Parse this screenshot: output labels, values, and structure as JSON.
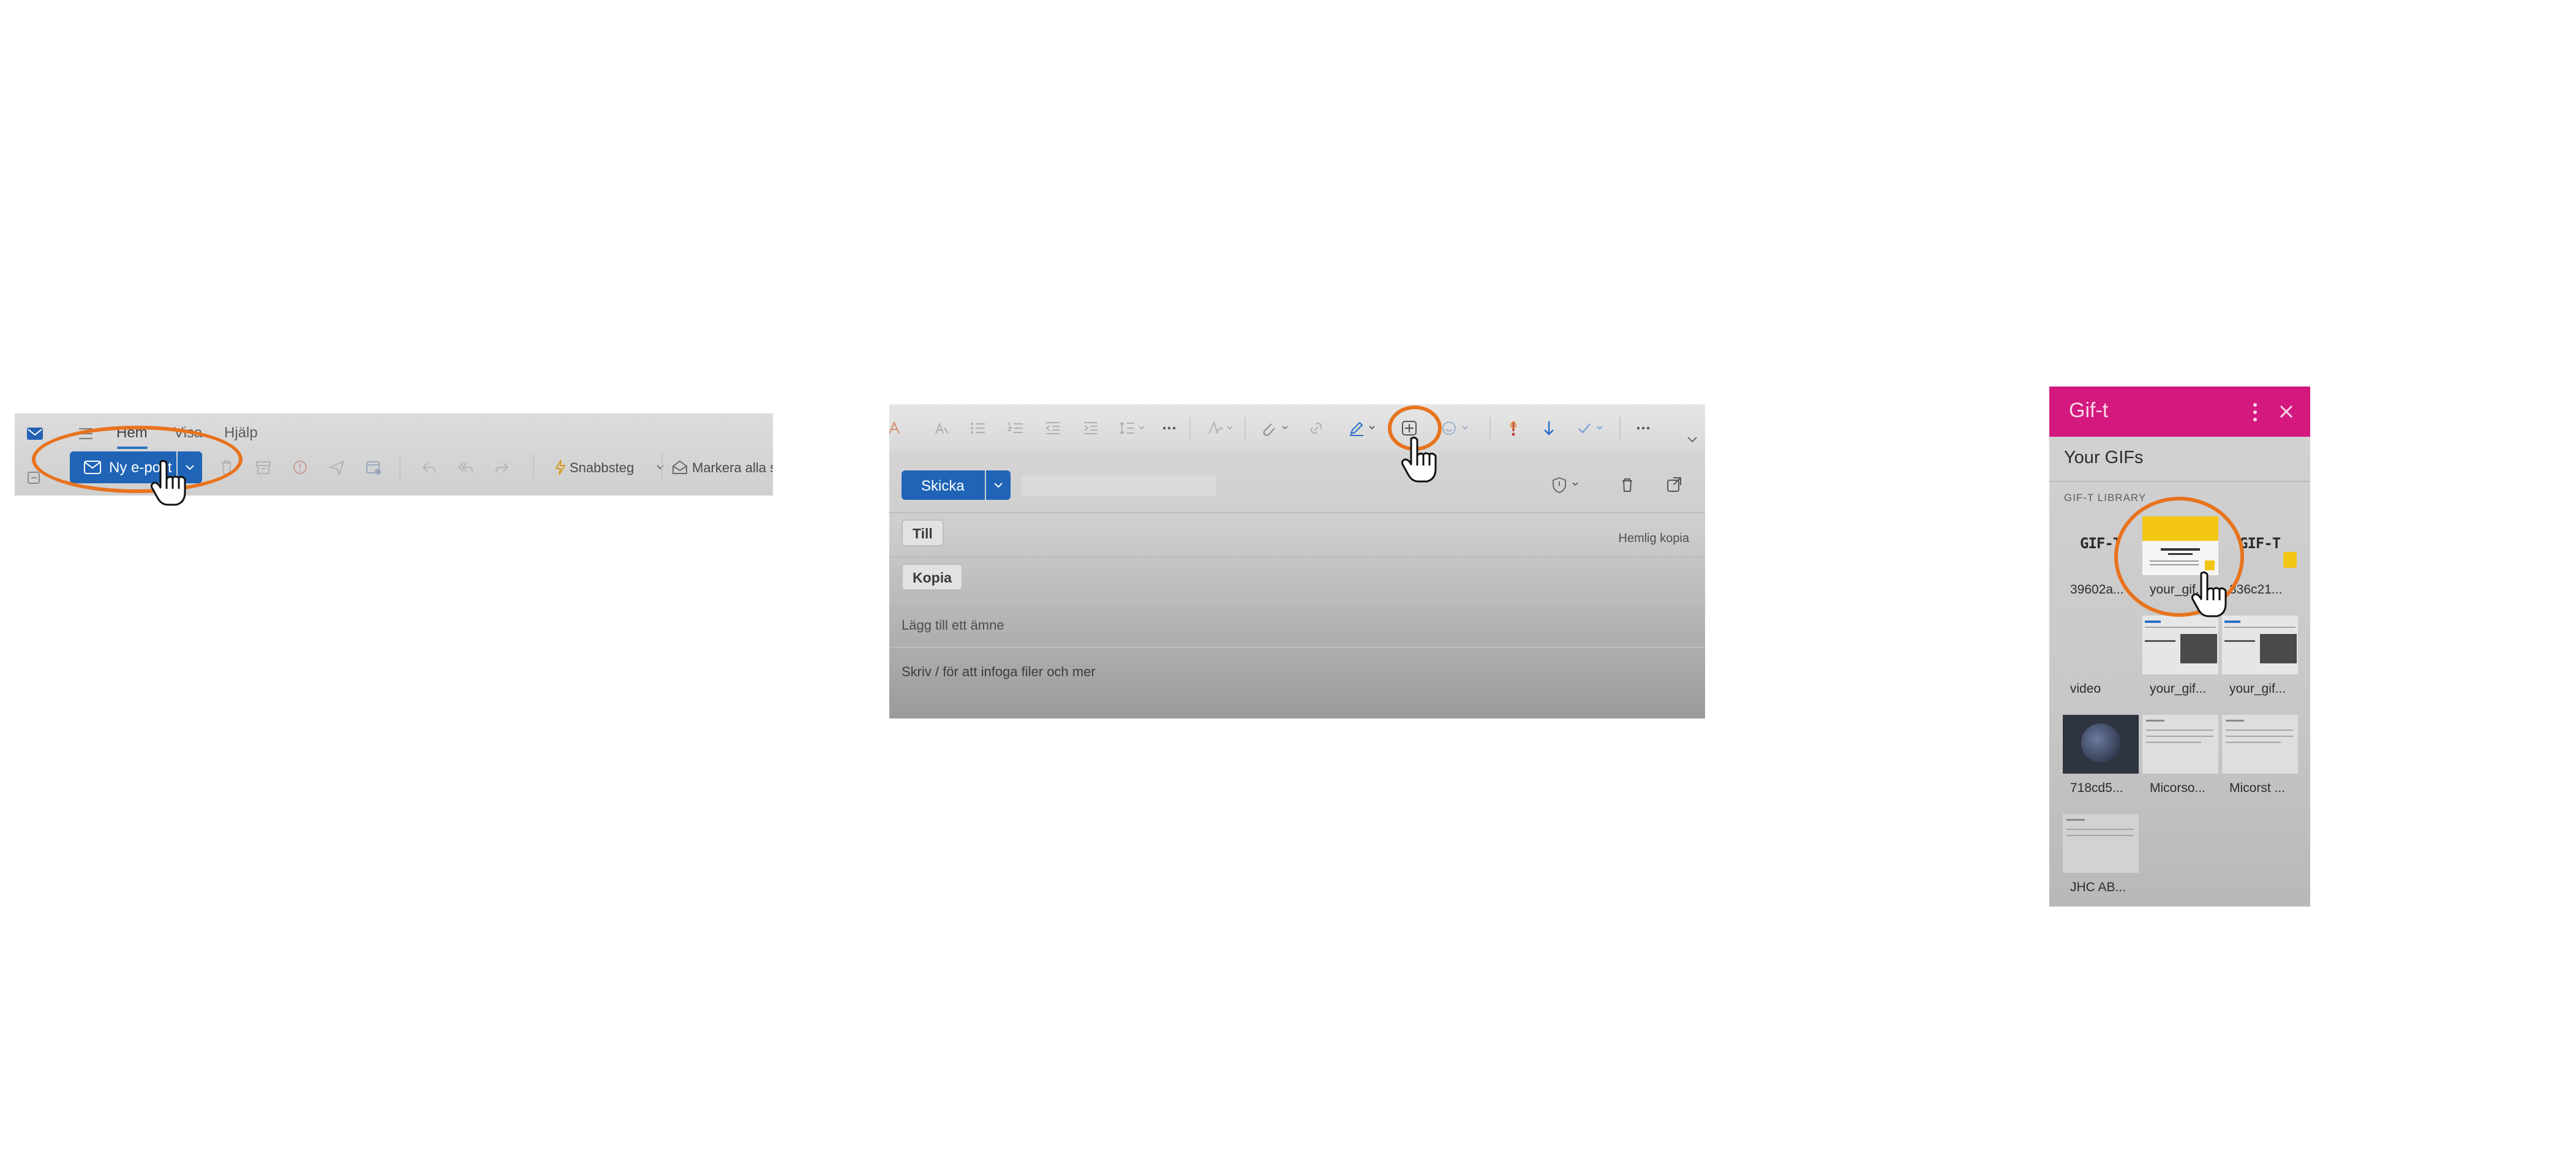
{
  "ribbon": {
    "menu_tabs": [
      {
        "label": "Hem",
        "active": true
      },
      {
        "label": "Visa",
        "active": false
      },
      {
        "label": "Hjälp",
        "active": false
      }
    ],
    "new_mail_label": "Ny e-post",
    "quick_steps_label": "Snabbsteg",
    "mark_all_label": "Markera alla s"
  },
  "compose": {
    "send_label": "Skicka",
    "to_label": "Till",
    "cc_label": "Kopia",
    "bcc_label": "Hemlig kopia",
    "subject_placeholder": "Lägg till ett ämne",
    "body_placeholder": "Skriv / för att infoga filer och mer"
  },
  "gift": {
    "title": "Gif-t",
    "section_title": "Your GIFs",
    "library_label": "GIF-T LIBRARY",
    "logo_text": "GIF-T",
    "items": [
      {
        "caption": "39602a...",
        "kind": "logo"
      },
      {
        "caption": "your_gif...",
        "kind": "yellow"
      },
      {
        "caption": "336c21...",
        "kind": "logo-badge"
      },
      {
        "caption": "video",
        "kind": "blank"
      },
      {
        "caption": "your_gif...",
        "kind": "web"
      },
      {
        "caption": "your_gif...",
        "kind": "web"
      },
      {
        "caption": "718cd5...",
        "kind": "dark"
      },
      {
        "caption": "Micorso...",
        "kind": "doc"
      },
      {
        "caption": "Micorst ...",
        "kind": "doc"
      },
      {
        "caption": "JHC AB...",
        "kind": "doc"
      }
    ]
  },
  "colors": {
    "accent_blue": "#1f64b6",
    "highlight_orange": "#e8731d",
    "gift_header": "#d4197e"
  }
}
